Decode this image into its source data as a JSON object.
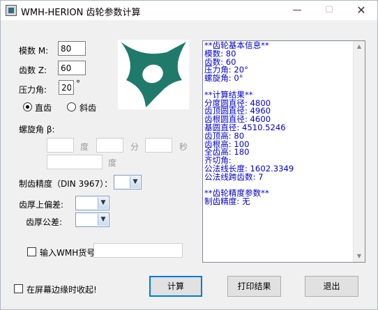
{
  "window": {
    "title": "WMH-HERION 齿轮参数计算",
    "min_glyph": "—",
    "max_glyph": "☐",
    "close_glyph": "✕"
  },
  "form": {
    "module_label": "模数 M:",
    "module_value": "80",
    "teeth_label": "齿数 Z:",
    "teeth_value": "60",
    "pressure_label": "压力角:",
    "pressure_value": "20",
    "pressure_unit": "°",
    "straight_label": "直齿",
    "helical_label": "斜齿",
    "gear_type_selected": "直齿",
    "helix_label": "螺旋角 β:",
    "deg_label": "度",
    "min_label": "分",
    "sec_label": "秒",
    "deg2_label": "度",
    "precision_label": "制齿精度（DIN 3967）：",
    "upper_dev_label": "齿厚上偏差:",
    "tolerance_label": "齿厚公差:",
    "wmh_label": "输入WMH货号",
    "collapse_label": "在屏幕边缘时收起!"
  },
  "output_lines": [
    "**齿轮基本信息**",
    "模数: 80",
    "齿数: 60",
    "压力角: 20°",
    "螺旋角: 0°",
    "",
    "**计算结果**",
    "分度圆直径: 4800",
    "齿顶圆直径: 4960",
    "齿根圆直径: 4600",
    "基圆直径: 4510.5246",
    "齿顶高: 80",
    "齿根高: 100",
    "全齿高: 180",
    "齐切角:",
    "公法线长度: 1602.3349",
    "公法线跨齿数: 7",
    "",
    "**齿轮精度参数**",
    "制齿精度: 无"
  ],
  "buttons": {
    "calc": "计算",
    "print": "打印结果",
    "exit": "退出"
  },
  "colors": {
    "logo": "#1f7a6b",
    "output_text": "#0000cc",
    "focus": "#0078d7"
  },
  "icons": {
    "logo": "herion-logo-icon",
    "app": "app-icon"
  }
}
